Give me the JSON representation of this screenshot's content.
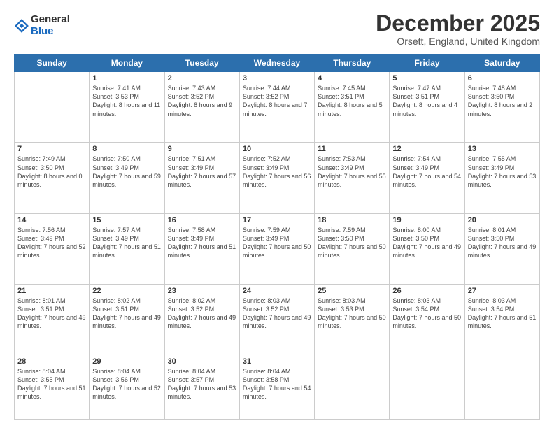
{
  "logo": {
    "general": "General",
    "blue": "Blue"
  },
  "header": {
    "month": "December 2025",
    "location": "Orsett, England, United Kingdom"
  },
  "weekdays": [
    "Sunday",
    "Monday",
    "Tuesday",
    "Wednesday",
    "Thursday",
    "Friday",
    "Saturday"
  ],
  "weeks": [
    [
      {
        "day": "",
        "sunrise": "",
        "sunset": "",
        "daylight": ""
      },
      {
        "day": "1",
        "sunrise": "Sunrise: 7:41 AM",
        "sunset": "Sunset: 3:53 PM",
        "daylight": "Daylight: 8 hours and 11 minutes."
      },
      {
        "day": "2",
        "sunrise": "Sunrise: 7:43 AM",
        "sunset": "Sunset: 3:52 PM",
        "daylight": "Daylight: 8 hours and 9 minutes."
      },
      {
        "day": "3",
        "sunrise": "Sunrise: 7:44 AM",
        "sunset": "Sunset: 3:52 PM",
        "daylight": "Daylight: 8 hours and 7 minutes."
      },
      {
        "day": "4",
        "sunrise": "Sunrise: 7:45 AM",
        "sunset": "Sunset: 3:51 PM",
        "daylight": "Daylight: 8 hours and 5 minutes."
      },
      {
        "day": "5",
        "sunrise": "Sunrise: 7:47 AM",
        "sunset": "Sunset: 3:51 PM",
        "daylight": "Daylight: 8 hours and 4 minutes."
      },
      {
        "day": "6",
        "sunrise": "Sunrise: 7:48 AM",
        "sunset": "Sunset: 3:50 PM",
        "daylight": "Daylight: 8 hours and 2 minutes."
      }
    ],
    [
      {
        "day": "7",
        "sunrise": "Sunrise: 7:49 AM",
        "sunset": "Sunset: 3:50 PM",
        "daylight": "Daylight: 8 hours and 0 minutes."
      },
      {
        "day": "8",
        "sunrise": "Sunrise: 7:50 AM",
        "sunset": "Sunset: 3:49 PM",
        "daylight": "Daylight: 7 hours and 59 minutes."
      },
      {
        "day": "9",
        "sunrise": "Sunrise: 7:51 AM",
        "sunset": "Sunset: 3:49 PM",
        "daylight": "Daylight: 7 hours and 57 minutes."
      },
      {
        "day": "10",
        "sunrise": "Sunrise: 7:52 AM",
        "sunset": "Sunset: 3:49 PM",
        "daylight": "Daylight: 7 hours and 56 minutes."
      },
      {
        "day": "11",
        "sunrise": "Sunrise: 7:53 AM",
        "sunset": "Sunset: 3:49 PM",
        "daylight": "Daylight: 7 hours and 55 minutes."
      },
      {
        "day": "12",
        "sunrise": "Sunrise: 7:54 AM",
        "sunset": "Sunset: 3:49 PM",
        "daylight": "Daylight: 7 hours and 54 minutes."
      },
      {
        "day": "13",
        "sunrise": "Sunrise: 7:55 AM",
        "sunset": "Sunset: 3:49 PM",
        "daylight": "Daylight: 7 hours and 53 minutes."
      }
    ],
    [
      {
        "day": "14",
        "sunrise": "Sunrise: 7:56 AM",
        "sunset": "Sunset: 3:49 PM",
        "daylight": "Daylight: 7 hours and 52 minutes."
      },
      {
        "day": "15",
        "sunrise": "Sunrise: 7:57 AM",
        "sunset": "Sunset: 3:49 PM",
        "daylight": "Daylight: 7 hours and 51 minutes."
      },
      {
        "day": "16",
        "sunrise": "Sunrise: 7:58 AM",
        "sunset": "Sunset: 3:49 PM",
        "daylight": "Daylight: 7 hours and 51 minutes."
      },
      {
        "day": "17",
        "sunrise": "Sunrise: 7:59 AM",
        "sunset": "Sunset: 3:49 PM",
        "daylight": "Daylight: 7 hours and 50 minutes."
      },
      {
        "day": "18",
        "sunrise": "Sunrise: 7:59 AM",
        "sunset": "Sunset: 3:50 PM",
        "daylight": "Daylight: 7 hours and 50 minutes."
      },
      {
        "day": "19",
        "sunrise": "Sunrise: 8:00 AM",
        "sunset": "Sunset: 3:50 PM",
        "daylight": "Daylight: 7 hours and 49 minutes."
      },
      {
        "day": "20",
        "sunrise": "Sunrise: 8:01 AM",
        "sunset": "Sunset: 3:50 PM",
        "daylight": "Daylight: 7 hours and 49 minutes."
      }
    ],
    [
      {
        "day": "21",
        "sunrise": "Sunrise: 8:01 AM",
        "sunset": "Sunset: 3:51 PM",
        "daylight": "Daylight: 7 hours and 49 minutes."
      },
      {
        "day": "22",
        "sunrise": "Sunrise: 8:02 AM",
        "sunset": "Sunset: 3:51 PM",
        "daylight": "Daylight: 7 hours and 49 minutes."
      },
      {
        "day": "23",
        "sunrise": "Sunrise: 8:02 AM",
        "sunset": "Sunset: 3:52 PM",
        "daylight": "Daylight: 7 hours and 49 minutes."
      },
      {
        "day": "24",
        "sunrise": "Sunrise: 8:03 AM",
        "sunset": "Sunset: 3:52 PM",
        "daylight": "Daylight: 7 hours and 49 minutes."
      },
      {
        "day": "25",
        "sunrise": "Sunrise: 8:03 AM",
        "sunset": "Sunset: 3:53 PM",
        "daylight": "Daylight: 7 hours and 50 minutes."
      },
      {
        "day": "26",
        "sunrise": "Sunrise: 8:03 AM",
        "sunset": "Sunset: 3:54 PM",
        "daylight": "Daylight: 7 hours and 50 minutes."
      },
      {
        "day": "27",
        "sunrise": "Sunrise: 8:03 AM",
        "sunset": "Sunset: 3:54 PM",
        "daylight": "Daylight: 7 hours and 51 minutes."
      }
    ],
    [
      {
        "day": "28",
        "sunrise": "Sunrise: 8:04 AM",
        "sunset": "Sunset: 3:55 PM",
        "daylight": "Daylight: 7 hours and 51 minutes."
      },
      {
        "day": "29",
        "sunrise": "Sunrise: 8:04 AM",
        "sunset": "Sunset: 3:56 PM",
        "daylight": "Daylight: 7 hours and 52 minutes."
      },
      {
        "day": "30",
        "sunrise": "Sunrise: 8:04 AM",
        "sunset": "Sunset: 3:57 PM",
        "daylight": "Daylight: 7 hours and 53 minutes."
      },
      {
        "day": "31",
        "sunrise": "Sunrise: 8:04 AM",
        "sunset": "Sunset: 3:58 PM",
        "daylight": "Daylight: 7 hours and 54 minutes."
      },
      {
        "day": "",
        "sunrise": "",
        "sunset": "",
        "daylight": ""
      },
      {
        "day": "",
        "sunrise": "",
        "sunset": "",
        "daylight": ""
      },
      {
        "day": "",
        "sunrise": "",
        "sunset": "",
        "daylight": ""
      }
    ]
  ]
}
